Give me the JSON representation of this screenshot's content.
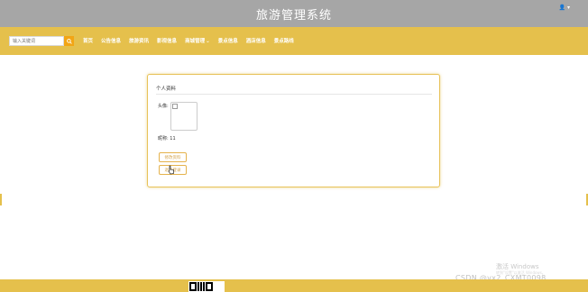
{
  "header": {
    "title": "旅游管理系统",
    "user_label": "👤 ▾"
  },
  "search": {
    "placeholder": "输入关键词"
  },
  "nav": {
    "items": [
      "首页",
      "公告信息",
      "旅游资讯",
      "影视信息",
      "商城管理",
      "景点信息",
      "酒店信息",
      "景点路线"
    ]
  },
  "profile": {
    "title": "个人资料",
    "avatar_label": "头像:",
    "nickname_label": "昵称:",
    "nickname_value": "11",
    "update_button": "修改资料",
    "logout_button": "退出登录"
  },
  "overlay": {
    "windows_activation": "激活 Windows",
    "windows_activation_sub": "转到\"设置\"以激活 Windows。",
    "csdn_watermark": "CSDN @vx2_CXMT0098"
  },
  "colors": {
    "header_bg": "#a6a6a6",
    "accent": "#e5c04c",
    "search_button": "#f2a515"
  }
}
